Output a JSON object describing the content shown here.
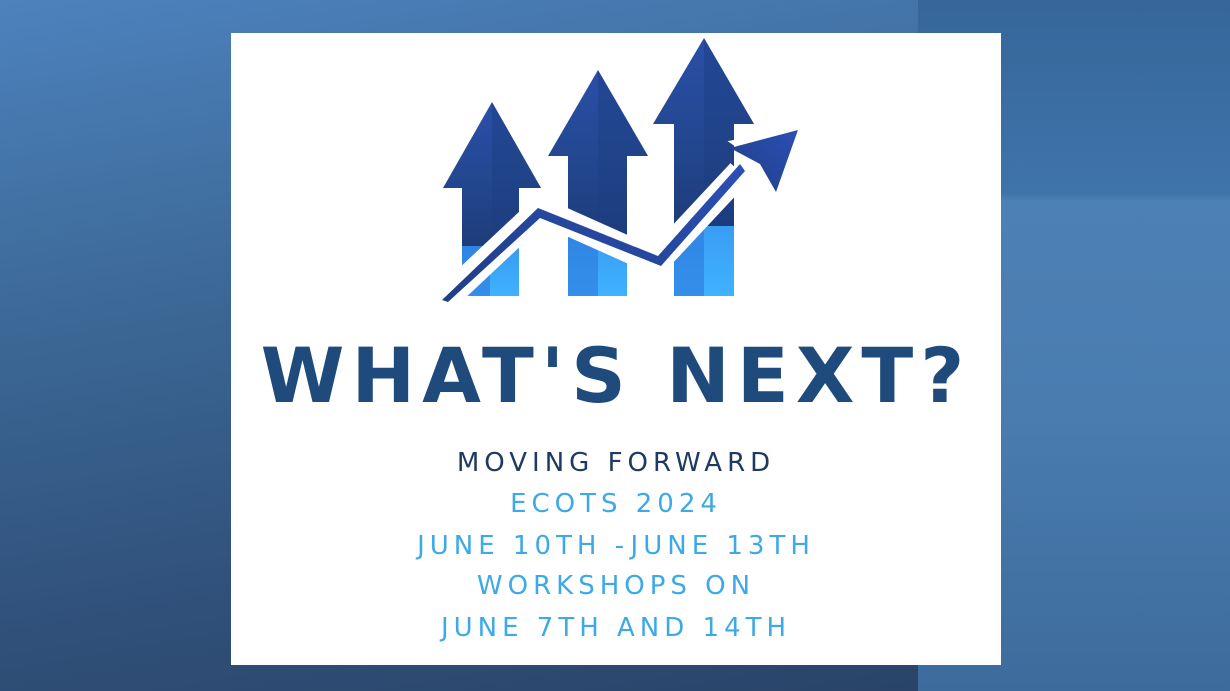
{
  "slide": {
    "headline": "WHAT'S NEXT?",
    "subtitle": "MOVING FORWARD",
    "event": "ECOTS 2024",
    "dates": "JUNE 10TH -JUNE 13TH",
    "workshops_line1": "WORKSHOPS ON",
    "workshops_line2": "JUNE 7TH AND 14TH"
  },
  "logo": {
    "icon": "growth-arrows-icon"
  },
  "colors": {
    "headline": "#1f4a7c",
    "subtitle": "#1e3a62",
    "details": "#3da9e6",
    "arrow_dark": "#22468d",
    "arrow_light": "#3aa8f5"
  }
}
